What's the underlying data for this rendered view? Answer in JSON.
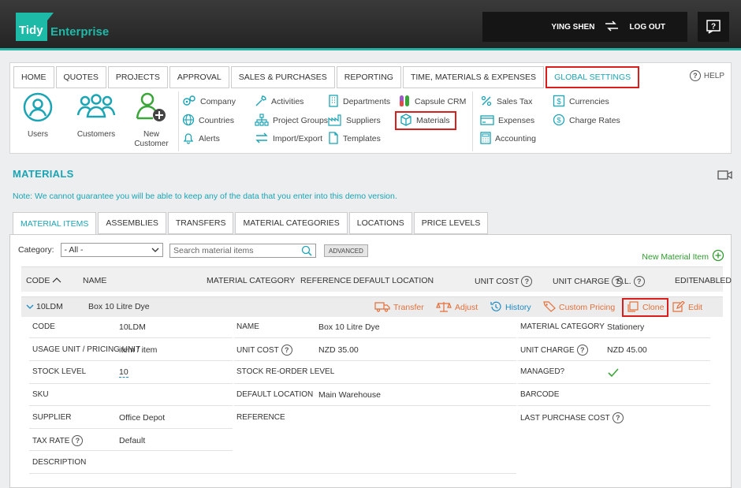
{
  "brand": {
    "part1": "Tidy",
    "part2": "Enterprise"
  },
  "user": {
    "name": "YING SHEN",
    "logout": "LOG OUT"
  },
  "tabs": [
    "HOME",
    "QUOTES",
    "PROJECTS",
    "APPROVAL",
    "SALES & PURCHASES",
    "REPORTING",
    "TIME, MATERIALS & EXPENSES",
    "GLOBAL SETTINGS"
  ],
  "help": "HELP",
  "big_icons": {
    "users": "Users",
    "customers": "Customers",
    "new_customer_1": "New",
    "new_customer_2": "Customer"
  },
  "menu": {
    "company": "Company",
    "countries": "Countries",
    "alerts": "Alerts",
    "activities": "Activities",
    "project_groups": "Project Groups",
    "import_export": "Import/Export",
    "departments": "Departments",
    "suppliers": "Suppliers",
    "templates": "Templates",
    "capsule_crm": "Capsule CRM",
    "materials": "Materials",
    "sales_tax": "Sales Tax",
    "expenses": "Expenses",
    "accounting": "Accounting",
    "currencies": "Currencies",
    "charge_rates": "Charge Rates"
  },
  "page": {
    "title": "MATERIALS",
    "note": "Note: We cannot guarantee you will be able to keep any of the data that you enter into this demo version."
  },
  "subtabs": [
    "MATERIAL ITEMS",
    "ASSEMBLIES",
    "TRANSFERS",
    "MATERIAL CATEGORIES",
    "LOCATIONS",
    "PRICE LEVELS"
  ],
  "filter": {
    "category_label": "Category:",
    "category_value": "- All -",
    "search_placeholder": "Search material items",
    "advanced": "ADVANCED",
    "new_item": "New Material Item"
  },
  "columns": {
    "code": "CODE",
    "name": "NAME",
    "material_category": "MATERIAL CATEGORY",
    "reference": "REFERENCE",
    "default_location": "DEFAULT LOCATION",
    "unit_cost": "UNIT COST",
    "unit_charge": "UNIT CHARGE",
    "sl": "S.L.",
    "edit": "EDIT",
    "enabled": "ENABLED"
  },
  "row": {
    "code": "10LDM",
    "name": "Box 10 Litre Dye"
  },
  "actions": {
    "transfer": "Transfer",
    "adjust": "Adjust",
    "history": "History",
    "custom_pricing": "Custom Pricing",
    "clone": "Clone",
    "edit": "Edit"
  },
  "detail": {
    "code_label": "CODE",
    "code_value": "10LDM",
    "usage_label": "USAGE UNIT / PRICING UNIT",
    "usage_value": "item / item",
    "stock_label": "STOCK LEVEL",
    "stock_value": "10",
    "sku_label": "SKU",
    "supplier_label": "SUPPLIER",
    "supplier_value": "Office Depot",
    "tax_label": "TAX RATE",
    "tax_value": "Default",
    "description_label": "DESCRIPTION",
    "name_label": "NAME",
    "name_value": "Box 10 Litre Dye",
    "unit_cost_label": "UNIT COST",
    "unit_cost_value": "NZD 35.00",
    "reorder_label": "STOCK RE-ORDER LEVEL",
    "default_location_label": "DEFAULT LOCATION",
    "default_location_value": "Main Warehouse",
    "reference_label": "REFERENCE",
    "category_label": "MATERIAL CATEGORY",
    "category_value": "Stationery",
    "unit_charge_label": "UNIT CHARGE",
    "unit_charge_value": "NZD 45.00",
    "managed_label": "MANAGED?",
    "barcode_label": "BARCODE",
    "last_cost_label": "LAST PURCHASE COST"
  },
  "colors": {
    "teal": "#1ba4b4",
    "orange": "#e2703a",
    "blue": "#1b8bc4",
    "green": "#2e9a2e",
    "highlight": "#d91e1e"
  }
}
